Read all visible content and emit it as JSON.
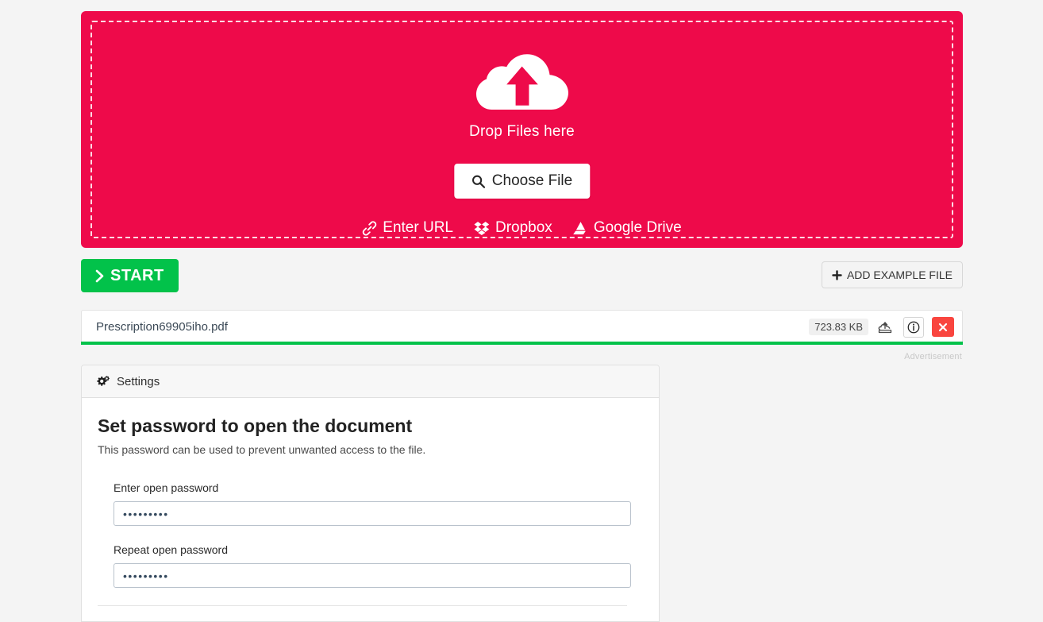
{
  "dropzone": {
    "icon": "cloud-upload-icon",
    "drop_text": "Drop Files here",
    "choose_file_label": "Choose File",
    "choose_file_icon": "search-icon",
    "sources": [
      {
        "label": "Enter URL",
        "icon": "link-icon"
      },
      {
        "label": "Dropbox",
        "icon": "dropbox-icon"
      },
      {
        "label": "Google Drive",
        "icon": "google-drive-icon"
      }
    ],
    "colors": {
      "background": "#ee0a4a",
      "border": "#ffffff"
    }
  },
  "action_bar": {
    "start_label": "START",
    "start_icon": "chevron-right-icon",
    "start_color": "#02c24a",
    "add_example_label": "ADD EXAMPLE FILE",
    "add_example_icon": "plus-icon"
  },
  "file_row": {
    "name": "Prescription69905iho.pdf",
    "size": "723.83 KB",
    "upload_icon": "cloud-upload-small-icon",
    "info_icon": "info-circle-icon",
    "remove_icon": "close-x-icon",
    "remove_color": "#f9453f",
    "progress_color": "#02c24a",
    "progress_percent": 100
  },
  "advertisement": {
    "label": "Advertisement"
  },
  "settings": {
    "header_icon": "cogs-icon",
    "header_label": "Settings",
    "title": "Set password to open the document",
    "description": "This password can be used to prevent unwanted access to the file.",
    "fields": [
      {
        "label": "Enter open password",
        "value": "•••••••••",
        "placeholder": ""
      },
      {
        "label": "Repeat open password",
        "value": "•••••••••",
        "placeholder": ""
      }
    ]
  }
}
